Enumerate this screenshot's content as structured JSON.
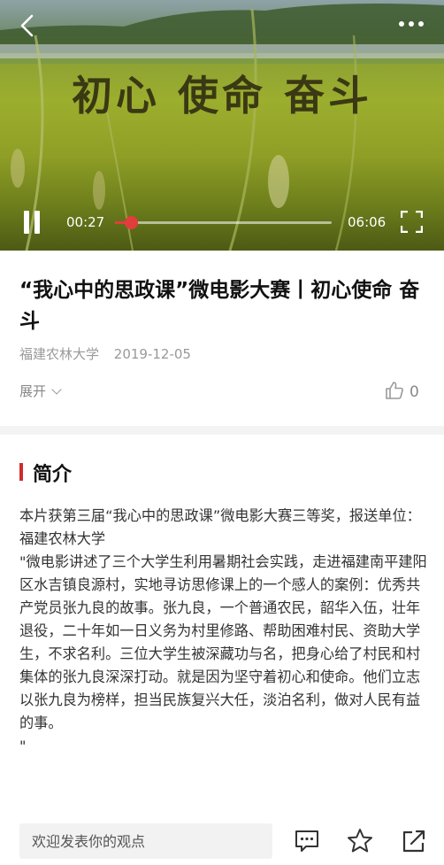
{
  "video": {
    "overlay_text": "初心 使命 奋斗",
    "current_time": "00:27",
    "duration": "06:06",
    "progress": 0.074,
    "accent_color": "#e23c3c"
  },
  "article": {
    "title": "“我心中的思政课”微电影大赛丨初心使命 奋斗",
    "source": "福建农林大学",
    "date": "2019-12-05",
    "expand_label": "展开",
    "like_count": "0"
  },
  "intro": {
    "heading": "简介",
    "accent_color": "#d22a2a",
    "text": "本片获第三届“我心中的思政课”微电影大赛三等奖，报送单位：福建农林大学\n\"微电影讲述了三个大学生利用暑期社会实践，走进福建南平建阳区水吉镇良源村，实地寻访思修课上的一个感人的案例：优秀共产党员张九良的故事。张九良，一个普通农民，韶华入伍，壮年退役，二十年如一日义务为村里修路、帮助困难村民、资助大学生，不求名利。三位大学生被深藏功与名，把身心给了村民和村集体的张九良深深打动。就是因为坚守着初心和使命。他们立志以张九良为榜样，担当民族复兴大任，淡泊名利，做对人民有益的事。\n\""
  },
  "bottom_bar": {
    "comment_placeholder": "欢迎发表你的观点",
    "icons": [
      "comment-icon",
      "star-icon",
      "share-icon"
    ]
  }
}
